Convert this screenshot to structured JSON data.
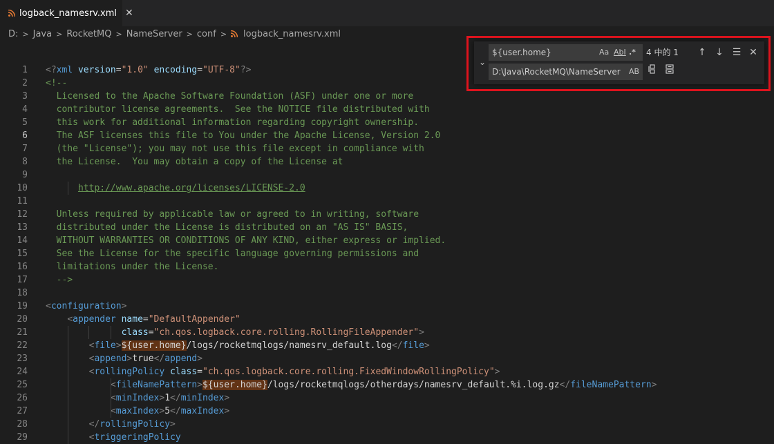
{
  "tab": {
    "title": "logback_namesrv.xml",
    "close": "✕"
  },
  "breadcrumb": [
    "D:",
    "Java",
    "RocketMQ",
    "NameServer",
    "conf",
    "logback_namesrv.xml"
  ],
  "find": {
    "search_value": "${user.home}",
    "match_case": "Aa",
    "whole_word": "AbI",
    "regex": ".*",
    "result_count": "4 中的 1",
    "prev": "↑",
    "next": "↓",
    "in_selection": "☰",
    "close": "✕",
    "replace_value": "D:\\Java\\RocketMQ\\NameServer",
    "preserve_case": "AB",
    "toggle": "⌄"
  },
  "colors": {
    "highlight_box": "#e0141e",
    "match_bg": "#623315",
    "comment": "#6a9955",
    "tag": "#569cd6",
    "attr": "#9cdcfe",
    "string": "#ce9178"
  },
  "editor": {
    "active_line": 6,
    "lines": [
      {
        "n": "1",
        "parts": [
          [
            "c-punc",
            "<?"
          ],
          [
            "c-tag",
            "xml"
          ],
          [
            "c-txt",
            " "
          ],
          [
            "c-attr",
            "version"
          ],
          [
            "c-txt",
            "="
          ],
          [
            "c-str",
            "\"1.0\""
          ],
          [
            "c-txt",
            " "
          ],
          [
            "c-attr",
            "encoding"
          ],
          [
            "c-txt",
            "="
          ],
          [
            "c-str",
            "\"UTF-8\""
          ],
          [
            "c-punc",
            "?>"
          ]
        ]
      },
      {
        "n": "2",
        "parts": [
          [
            "c-com",
            "<!--"
          ]
        ]
      },
      {
        "n": "3",
        "parts": [
          [
            "c-com",
            "  Licensed to the Apache Software Foundation (ASF) under one or more"
          ]
        ]
      },
      {
        "n": "4",
        "parts": [
          [
            "c-com",
            "  contributor license agreements.  See the NOTICE file distributed with"
          ]
        ]
      },
      {
        "n": "5",
        "parts": [
          [
            "c-com",
            "  this work for additional information regarding copyright ownership."
          ]
        ]
      },
      {
        "n": "6",
        "parts": [
          [
            "c-com",
            "  The ASF licenses this file to You under the Apache License, Version 2.0"
          ]
        ]
      },
      {
        "n": "7",
        "parts": [
          [
            "c-com",
            "  (the \"License\"); you may not use this file except in compliance with"
          ]
        ]
      },
      {
        "n": "8",
        "parts": [
          [
            "c-com",
            "  the License.  You may obtain a copy of the License at"
          ]
        ]
      },
      {
        "n": "9",
        "parts": []
      },
      {
        "n": "10",
        "parts": [
          [
            "c-com",
            "      "
          ],
          [
            "c-link",
            "http://www.apache.org/licenses/LICENSE-2.0"
          ]
        ]
      },
      {
        "n": "11",
        "parts": []
      },
      {
        "n": "12",
        "parts": [
          [
            "c-com",
            "  Unless required by applicable law or agreed to in writing, software"
          ]
        ]
      },
      {
        "n": "13",
        "parts": [
          [
            "c-com",
            "  distributed under the License is distributed on an \"AS IS\" BASIS,"
          ]
        ]
      },
      {
        "n": "14",
        "parts": [
          [
            "c-com",
            "  WITHOUT WARRANTIES OR CONDITIONS OF ANY KIND, either express or implied."
          ]
        ]
      },
      {
        "n": "15",
        "parts": [
          [
            "c-com",
            "  See the License for the specific language governing permissions and"
          ]
        ]
      },
      {
        "n": "16",
        "parts": [
          [
            "c-com",
            "  limitations under the License."
          ]
        ]
      },
      {
        "n": "17",
        "parts": [
          [
            "c-com",
            "  -->"
          ]
        ]
      },
      {
        "n": "18",
        "parts": []
      },
      {
        "n": "19",
        "parts": [
          [
            "c-punc",
            "<"
          ],
          [
            "c-tag",
            "configuration"
          ],
          [
            "c-punc",
            ">"
          ]
        ]
      },
      {
        "n": "20",
        "parts": [
          [
            "c-txt",
            "    "
          ],
          [
            "c-punc",
            "<"
          ],
          [
            "c-tag",
            "appender"
          ],
          [
            "c-txt",
            " "
          ],
          [
            "c-attr",
            "name"
          ],
          [
            "c-txt",
            "="
          ],
          [
            "c-str",
            "\"DefaultAppender\""
          ]
        ]
      },
      {
        "n": "21",
        "parts": [
          [
            "c-txt",
            "              "
          ],
          [
            "c-attr",
            "class"
          ],
          [
            "c-txt",
            "="
          ],
          [
            "c-str",
            "\"ch.qos.logback.core.rolling.RollingFileAppender\""
          ],
          [
            "c-punc",
            ">"
          ]
        ]
      },
      {
        "n": "22",
        "parts": [
          [
            "c-txt",
            "        "
          ],
          [
            "c-punc",
            "<"
          ],
          [
            "c-tag",
            "file"
          ],
          [
            "c-punc",
            ">"
          ],
          [
            "c-txt hl",
            "${user.home}"
          ],
          [
            "c-txt",
            "/logs/rocketmqlogs/namesrv_default.log"
          ],
          [
            "c-punc",
            "</"
          ],
          [
            "c-tag",
            "file"
          ],
          [
            "c-punc",
            ">"
          ]
        ]
      },
      {
        "n": "23",
        "parts": [
          [
            "c-txt",
            "        "
          ],
          [
            "c-punc",
            "<"
          ],
          [
            "c-tag",
            "append"
          ],
          [
            "c-punc",
            ">"
          ],
          [
            "c-txt",
            "true"
          ],
          [
            "c-punc",
            "</"
          ],
          [
            "c-tag",
            "append"
          ],
          [
            "c-punc",
            ">"
          ]
        ]
      },
      {
        "n": "24",
        "parts": [
          [
            "c-txt",
            "        "
          ],
          [
            "c-punc",
            "<"
          ],
          [
            "c-tag",
            "rollingPolicy"
          ],
          [
            "c-txt",
            " "
          ],
          [
            "c-attr",
            "class"
          ],
          [
            "c-txt",
            "="
          ],
          [
            "c-str",
            "\"ch.qos.logback.core.rolling.FixedWindowRollingPolicy\""
          ],
          [
            "c-punc",
            ">"
          ]
        ]
      },
      {
        "n": "25",
        "parts": [
          [
            "c-txt",
            "            "
          ],
          [
            "c-punc",
            "<"
          ],
          [
            "c-tag",
            "fileNamePattern"
          ],
          [
            "c-punc",
            ">"
          ],
          [
            "c-txt hl",
            "${user.home}"
          ],
          [
            "c-txt",
            "/logs/rocketmqlogs/otherdays/namesrv_default.%i.log.gz"
          ],
          [
            "c-punc",
            "</"
          ],
          [
            "c-tag",
            "fileNamePattern"
          ],
          [
            "c-punc",
            ">"
          ]
        ]
      },
      {
        "n": "26",
        "parts": [
          [
            "c-txt",
            "            "
          ],
          [
            "c-punc",
            "<"
          ],
          [
            "c-tag",
            "minIndex"
          ],
          [
            "c-punc",
            ">"
          ],
          [
            "c-txt",
            "1"
          ],
          [
            "c-punc",
            "</"
          ],
          [
            "c-tag",
            "minIndex"
          ],
          [
            "c-punc",
            ">"
          ]
        ]
      },
      {
        "n": "27",
        "parts": [
          [
            "c-txt",
            "            "
          ],
          [
            "c-punc",
            "<"
          ],
          [
            "c-tag",
            "maxIndex"
          ],
          [
            "c-punc",
            ">"
          ],
          [
            "c-txt",
            "5"
          ],
          [
            "c-punc",
            "</"
          ],
          [
            "c-tag",
            "maxIndex"
          ],
          [
            "c-punc",
            ">"
          ]
        ]
      },
      {
        "n": "28",
        "parts": [
          [
            "c-txt",
            "        "
          ],
          [
            "c-punc",
            "</"
          ],
          [
            "c-tag",
            "rollingPolicy"
          ],
          [
            "c-punc",
            ">"
          ]
        ]
      },
      {
        "n": "29",
        "parts": [
          [
            "c-txt",
            "        "
          ],
          [
            "c-punc",
            "<"
          ],
          [
            "c-tag",
            "triggeringPolicy"
          ]
        ]
      }
    ]
  }
}
